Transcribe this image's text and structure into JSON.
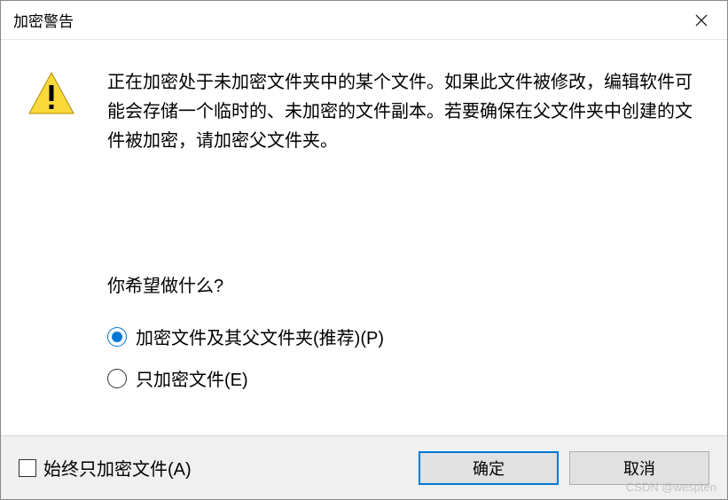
{
  "titlebar": {
    "title": "加密警告"
  },
  "message": "正在加密处于未加密文件夹中的某个文件。如果此文件被修改，编辑软件可能会存储一个临时的、未加密的文件副本。若要确保在父文件夹中创建的文件被加密，请加密父文件夹。",
  "question": "你希望做什么?",
  "options": {
    "encrypt_parent": "加密文件及其父文件夹(推荐)(P)",
    "encrypt_file_only": "只加密文件(E)"
  },
  "footer": {
    "always_checkbox": "始终只加密文件(A)",
    "ok": "确定",
    "cancel": "取消"
  },
  "watermark": "CSDN @wespten"
}
